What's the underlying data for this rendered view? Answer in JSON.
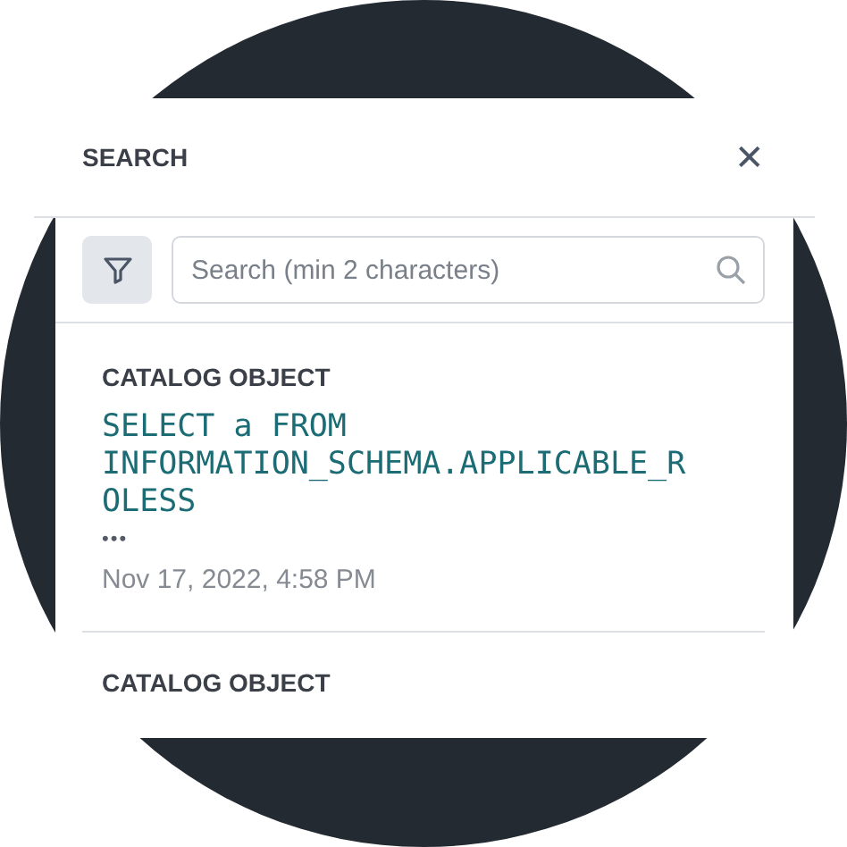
{
  "header": {
    "title": "SEARCH",
    "close": "✕"
  },
  "search": {
    "placeholder": "Search (min 2 characters)"
  },
  "results": [
    {
      "type": "CATALOG OBJECT",
      "query": "SELECT a FROM INFORMATION_SCHEMA.APPLICABLE_ROLESS",
      "more": "•••",
      "date": "Nov 17, 2022, 4:58 PM"
    },
    {
      "type": "CATALOG OBJECT"
    }
  ]
}
